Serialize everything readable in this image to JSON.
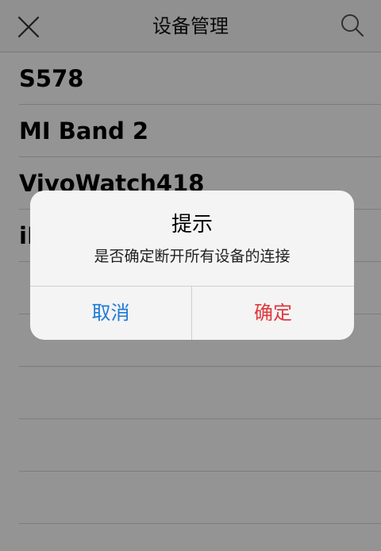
{
  "nav": {
    "title": "设备管理",
    "close_icon": "close-icon",
    "search_icon": "search-icon"
  },
  "devices": [
    {
      "name": "S578"
    },
    {
      "name": "MI Band 2"
    },
    {
      "name": "VivoWatch418"
    },
    {
      "name": "iL"
    },
    {
      "name": ""
    },
    {
      "name": ""
    },
    {
      "name": ""
    },
    {
      "name": ""
    },
    {
      "name": ""
    }
  ],
  "dialog": {
    "title": "提示",
    "message": "是否确定断开所有设备的连接",
    "cancel_label": "取消",
    "confirm_label": "确定"
  },
  "colors": {
    "cancel": "#1e7ad6",
    "confirm": "#e0393e",
    "overlay": "rgba(0,0,0,0.42)"
  }
}
